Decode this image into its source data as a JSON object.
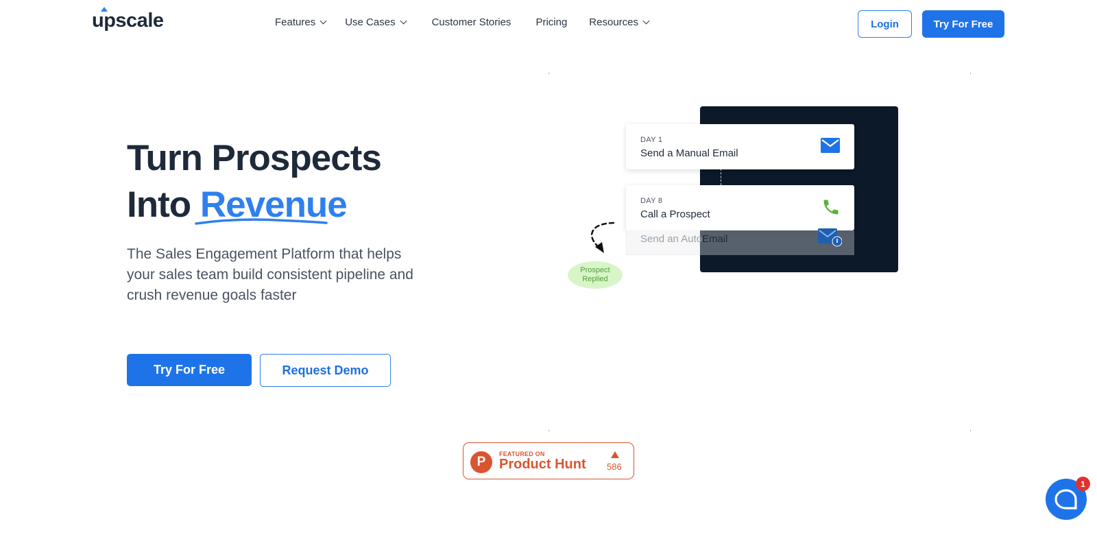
{
  "brand": {
    "name": "upscale",
    "accent_color": "#1f73e8"
  },
  "nav": {
    "items": [
      {
        "label": "Features",
        "has_dropdown": true
      },
      {
        "label": "Use Cases",
        "has_dropdown": true
      },
      {
        "label": "Customer Stories",
        "has_dropdown": false
      },
      {
        "label": "Pricing",
        "has_dropdown": false
      },
      {
        "label": "Resources",
        "has_dropdown": true
      }
    ],
    "login_label": "Login",
    "try_label": "Try For Free"
  },
  "hero": {
    "headline_line1": "Turn Prospects",
    "headline_line2_prefix": "Into ",
    "headline_accent": "Revenue",
    "subtext": "The Sales Engagement Platform that helps your sales team build consistent pipeline and crush revenue goals faster",
    "primary_cta": "Try For Free",
    "secondary_cta": "Request Demo"
  },
  "illustration": {
    "cards": [
      {
        "day": "DAY 1",
        "title": "Send a Manual Email",
        "icon": "envelope-icon"
      },
      {
        "day": "DAY 8",
        "title": "Call a Prospect",
        "icon": "phone-icon"
      }
    ],
    "ghost_card_a": "Send an Auto",
    "ghost_card_b": "Email",
    "replied_badge": "Prospect Replied"
  },
  "product_hunt": {
    "featured_label": "FEATURED ON",
    "name": "Product Hunt",
    "logo_letter": "P",
    "upvotes": "586"
  },
  "chat": {
    "unread_count": "1",
    "icon": "chat-bubble-icon"
  }
}
